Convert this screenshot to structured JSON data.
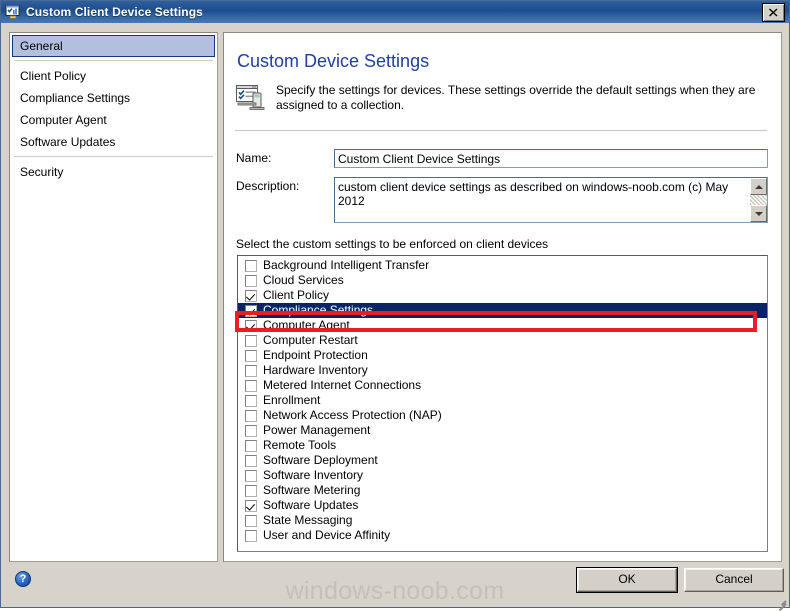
{
  "window": {
    "title": "Custom Client Device Settings",
    "icon": "settings-monitor-icon",
    "close_label": "✕"
  },
  "sidebar": {
    "items": [
      {
        "label": "General",
        "selected": true
      },
      {
        "label": "Client Policy",
        "selected": false
      },
      {
        "label": "Compliance Settings",
        "selected": false
      },
      {
        "label": "Computer Agent",
        "selected": false
      },
      {
        "label": "Software Updates",
        "selected": false
      },
      {
        "label": "Security",
        "selected": false
      }
    ]
  },
  "content": {
    "page_title": "Custom Device Settings",
    "blurb_icon": "device-settings-icon",
    "blurb": "Specify the settings for devices. These settings override the default settings when they are assigned to a collection.",
    "name_label": "Name:",
    "name_value": "Custom Client Device Settings",
    "description_label": "Description:",
    "description_value": "custom client device settings as described on windows-noob.com (c) May 2012",
    "group_caption": "Select the custom settings to be enforced on client devices",
    "settings": [
      {
        "label": "Background Intelligent Transfer",
        "checked": false,
        "selected": false
      },
      {
        "label": "Cloud Services",
        "checked": false,
        "selected": false
      },
      {
        "label": "Client Policy",
        "checked": true,
        "selected": false
      },
      {
        "label": "Compliance Settings",
        "checked": true,
        "selected": true
      },
      {
        "label": "Computer Agent",
        "checked": true,
        "selected": false
      },
      {
        "label": "Computer Restart",
        "checked": false,
        "selected": false
      },
      {
        "label": "Endpoint Protection",
        "checked": false,
        "selected": false
      },
      {
        "label": "Hardware Inventory",
        "checked": false,
        "selected": false
      },
      {
        "label": "Metered Internet Connections",
        "checked": false,
        "selected": false
      },
      {
        "label": "Enrollment",
        "checked": false,
        "selected": false
      },
      {
        "label": "Network Access Protection (NAP)",
        "checked": false,
        "selected": false
      },
      {
        "label": "Power Management",
        "checked": false,
        "selected": false
      },
      {
        "label": "Remote Tools",
        "checked": false,
        "selected": false
      },
      {
        "label": "Software Deployment",
        "checked": false,
        "selected": false
      },
      {
        "label": "Software Inventory",
        "checked": false,
        "selected": false
      },
      {
        "label": "Software Metering",
        "checked": false,
        "selected": false
      },
      {
        "label": "Software Updates",
        "checked": true,
        "selected": false
      },
      {
        "label": "State Messaging",
        "checked": false,
        "selected": false
      },
      {
        "label": "User and Device Affinity",
        "checked": false,
        "selected": false
      }
    ]
  },
  "annotation": {
    "color": "#ec1c24",
    "target": "Compliance Settings"
  },
  "footer": {
    "help_label": "?",
    "watermark": "windows-noob.com",
    "ok_label": "OK",
    "cancel_label": "Cancel"
  },
  "colors": {
    "title_bar": "#1d4c8c",
    "heading": "#1e3fa0",
    "selection": "#0a246a",
    "nav_selection": "#b3c0dd",
    "dialog_face": "#d7d3cb",
    "annotation": "#ec1c24"
  }
}
